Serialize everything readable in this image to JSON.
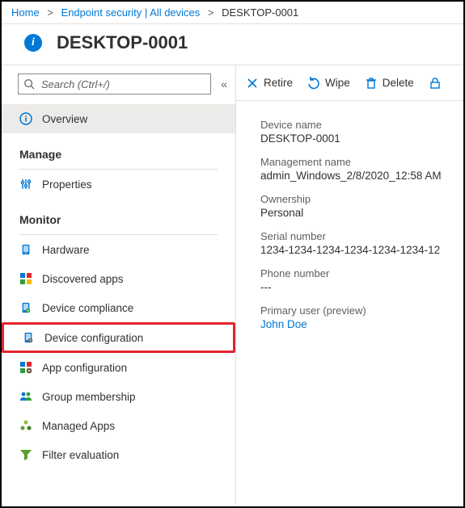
{
  "breadcrumb": {
    "home": "Home",
    "second": "Endpoint security | All devices",
    "current": "DESKTOP-0001"
  },
  "header": {
    "title": "DESKTOP-0001"
  },
  "search": {
    "placeholder": "Search (Ctrl+/)"
  },
  "nav": {
    "overview": "Overview",
    "group_manage": "Manage",
    "properties": "Properties",
    "group_monitor": "Monitor",
    "hardware": "Hardware",
    "discovered_apps": "Discovered apps",
    "device_compliance": "Device compliance",
    "device_configuration": "Device configuration",
    "app_configuration": "App configuration",
    "group_membership": "Group membership",
    "managed_apps": "Managed Apps",
    "filter_evaluation": "Filter evaluation"
  },
  "toolbar": {
    "retire": "Retire",
    "wipe": "Wipe",
    "delete": "Delete"
  },
  "props": {
    "device_name": {
      "label": "Device name",
      "value": "DESKTOP-0001"
    },
    "management_name": {
      "label": "Management name",
      "value": "admin_Windows_2/8/2020_12:58 AM"
    },
    "ownership": {
      "label": "Ownership",
      "value": "Personal"
    },
    "serial": {
      "label": "Serial number",
      "value": "1234-1234-1234-1234-1234-1234-12"
    },
    "phone": {
      "label": "Phone number",
      "value": "---"
    },
    "primary_user": {
      "label": "Primary user (preview)",
      "value": "John Doe"
    }
  }
}
